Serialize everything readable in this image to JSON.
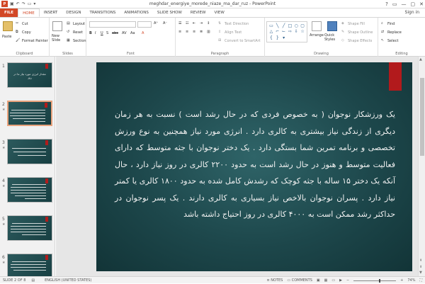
{
  "window": {
    "title": "meghdar_energiye_morede_niaze_ma_dar_ruz - PowerPoint",
    "app_icon": "P",
    "controls": [
      "?",
      "▭",
      "—",
      "▢",
      "✕"
    ]
  },
  "tabs": [
    "FILE",
    "HOME",
    "INSERT",
    "DESIGN",
    "TRANSITIONS",
    "ANIMATIONS",
    "SLIDE SHOW",
    "REVIEW",
    "VIEW"
  ],
  "active_tab": "HOME",
  "signin": "Sign in",
  "ribbon": {
    "clipboard": {
      "paste": "Paste",
      "cut": "Cut",
      "copy": "Copy",
      "format_painter": "Format Painter",
      "label": "Clipboard"
    },
    "slides": {
      "new_slide": "New Slide",
      "layout": "Layout",
      "reset": "Reset",
      "section": "Section",
      "label": "Slides"
    },
    "font": {
      "label": "Font"
    },
    "paragraph": {
      "text_direction": "Text Direction",
      "align_text": "Align Text",
      "convert_smartart": "Convert to SmartArt",
      "label": "Paragraph"
    },
    "drawing": {
      "arrange": "Arrange",
      "quick_styles": "Quick Styles",
      "shape_fill": "Shape Fill",
      "shape_outline": "Shape Outline",
      "shape_effects": "Shape Effects",
      "label": "Drawing"
    },
    "editing": {
      "find": "Find",
      "replace": "Replace",
      "select": "Select",
      "label": "Editing"
    }
  },
  "thumbnails": [
    {
      "num": "1",
      "title": "مقدار انرژی مورد نیاز ما در روز"
    },
    {
      "num": "2",
      "title": ""
    },
    {
      "num": "3",
      "title": ""
    },
    {
      "num": "4",
      "title": ""
    },
    {
      "num": "5",
      "title": ""
    },
    {
      "num": "6",
      "title": ""
    }
  ],
  "slide": {
    "body": "یک ورزشکار نوجوان ( به خصوص فردی که در حال رشد است ) نسبت به هر زمان دیگری از زندگی نیاز بیشتری به کالری دارد . انرژی مورد نیاز همچنین به نوع ورزش تخصصی و برنامه تمرین شما بستگی دارد . یک دختر نوجوان با جثه متوسط که دارای فعالیت متوسط و هنوز در حال رشد است به حدود ۲۲۰۰ کالری در روز نیاز دارد ، حال آنکه یک دختر ۱۵ ساله با جثه کوچک که رشدش کامل شده به حدود ۱۸۰۰ کالری یا کمتر نیاز دارد . پسران نوجوان بالاخص نیاز بسیاری به کالری دارند . یک پسر نوجوان در حداکثر رشد ممکن است به ۴۰۰۰ کالری در روز احتیاج داشته باشد"
  },
  "status": {
    "slide_of": "SLIDE 2 OF 8",
    "language": "ENGLISH (UNITED STATES)",
    "notes": "NOTES",
    "comments": "COMMENTS",
    "zoom": "74%"
  },
  "colors": {
    "accent": "#d24726",
    "slide_bg": "#1d474b",
    "slide_bar": "#b21a1c"
  }
}
